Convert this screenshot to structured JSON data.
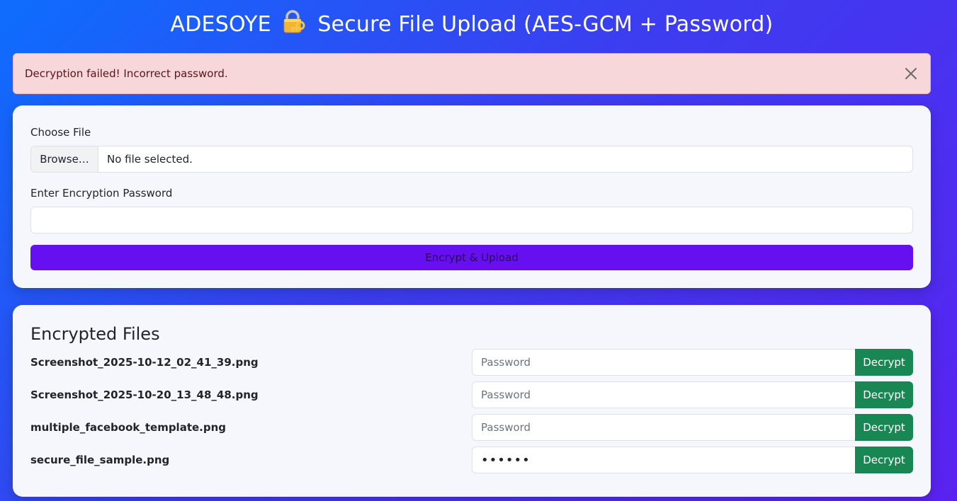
{
  "header": {
    "title_prefix": "ADESOYE",
    "title_suffix": "Secure File Upload (AES-GCM + Password)",
    "icon": "lock-with-key-icon"
  },
  "alert": {
    "message": "Decryption failed! Incorrect password.",
    "close_icon": "close-icon",
    "color": "#f8d7da"
  },
  "upload": {
    "file_label": "Choose File",
    "browse_label": "Browse…",
    "file_status": "No file selected.",
    "password_label": "Enter Encryption Password",
    "password_value": "",
    "submit_label": "Encrypt & Upload",
    "submit_color": "#6610f2"
  },
  "files": {
    "title": "Encrypted Files",
    "decrypt_color": "#198754",
    "items": [
      {
        "name": "Screenshot_2025-10-12_02_41_39.png",
        "password_placeholder": "Password",
        "password_value": "",
        "action": "Decrypt"
      },
      {
        "name": "Screenshot_2025-10-20_13_48_48.png",
        "password_placeholder": "Password",
        "password_value": "",
        "action": "Decrypt"
      },
      {
        "name": "multiple_facebook_template.png",
        "password_placeholder": "Password",
        "password_value": "",
        "action": "Decrypt"
      },
      {
        "name": "secure_file_sample.png",
        "password_placeholder": "Password",
        "password_value": "••••••",
        "action": "Decrypt"
      }
    ]
  }
}
